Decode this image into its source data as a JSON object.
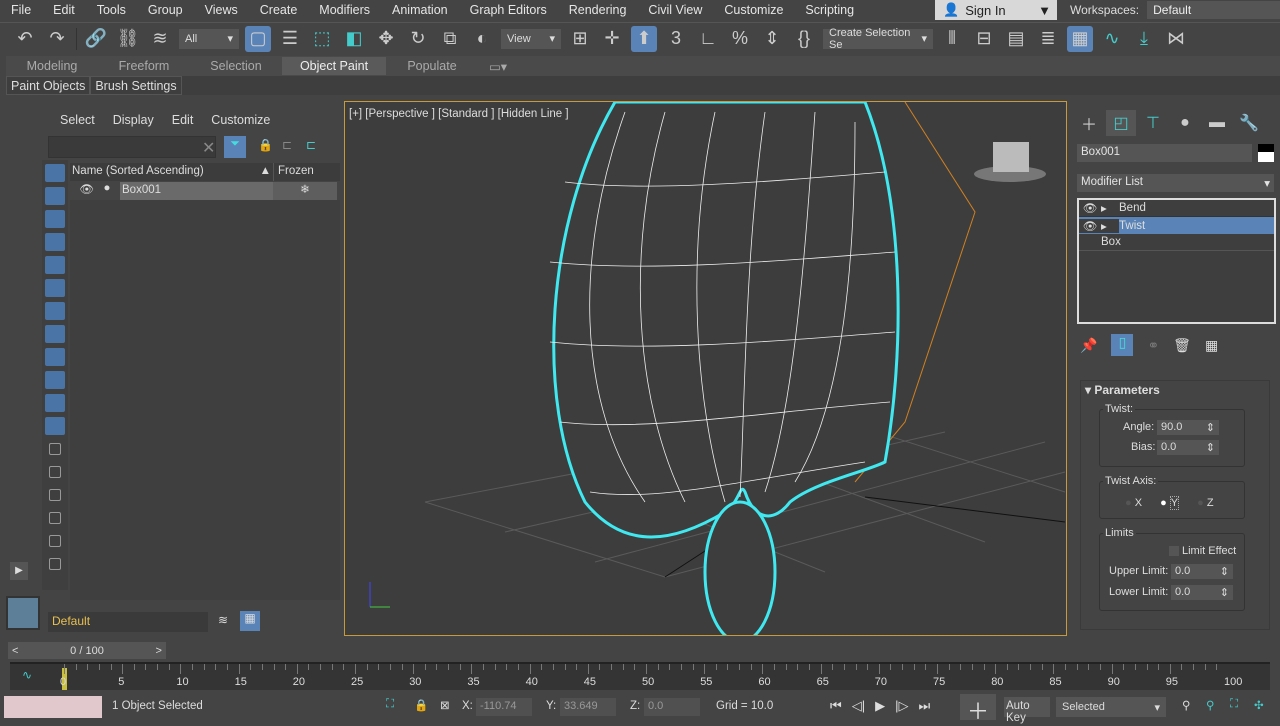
{
  "menu": [
    "File",
    "Edit",
    "Tools",
    "Group",
    "Views",
    "Create",
    "Modifiers",
    "Animation",
    "Graph Editors",
    "Rendering",
    "Civil View",
    "Customize",
    "Scripting"
  ],
  "signin": "Sign In",
  "workspaces": {
    "label": "Workspaces:",
    "value": "Default"
  },
  "toolbar": {
    "filter": "All",
    "refcoord": "View",
    "selset": "Create Selection Se"
  },
  "ribbon": {
    "tabs": [
      "Modeling",
      "Freeform",
      "Selection",
      "Object Paint",
      "Populate"
    ],
    "active": "Object Paint",
    "sub": [
      "Paint Objects",
      "Brush Settings"
    ]
  },
  "explorer": {
    "menu": [
      "Select",
      "Display",
      "Edit",
      "Customize"
    ],
    "col_name": "Name (Sorted Ascending)",
    "col_frozen": "Frozen",
    "rows": [
      {
        "name": "Box001"
      }
    ],
    "layer": "Default"
  },
  "viewport": {
    "label": "[+] [Perspective ] [Standard ] [Hidden Line ]"
  },
  "command": {
    "object_name": "Box001",
    "modifier_list": "Modifier List",
    "stack": [
      {
        "name": "Bend",
        "selected": false
      },
      {
        "name": "Twist",
        "selected": true
      },
      {
        "name": "Box",
        "selected": false
      }
    ],
    "rollout": "Parameters",
    "twist_group": "Twist:",
    "angle_label": "Angle:",
    "angle": "90.0",
    "bias_label": "Bias:",
    "bias": "0.0",
    "axis_group": "Twist Axis:",
    "axes": [
      "X",
      "Y",
      "Z"
    ],
    "axis_selected": "Y",
    "limits_group": "Limits",
    "limit_effect": "Limit Effect",
    "limit_effect_checked": false,
    "upper_label": "Upper Limit:",
    "upper": "0.0",
    "lower_label": "Lower Limit:",
    "lower": "0.0"
  },
  "timeline": {
    "frame": "0 / 100",
    "ticks": [
      "0",
      "5",
      "10",
      "15",
      "20",
      "25",
      "30",
      "35",
      "40",
      "45",
      "50",
      "55",
      "60",
      "65",
      "70",
      "75",
      "80",
      "85",
      "90",
      "95",
      "100"
    ]
  },
  "status": {
    "selected": "1 Object Selected",
    "x_label": "X:",
    "x": "-110.74",
    "y_label": "Y:",
    "y": "33.649",
    "z_label": "Z:",
    "z": "0.0",
    "grid": "Grid = 10.0",
    "autokey": "Auto Key",
    "keymode": "Selected"
  }
}
